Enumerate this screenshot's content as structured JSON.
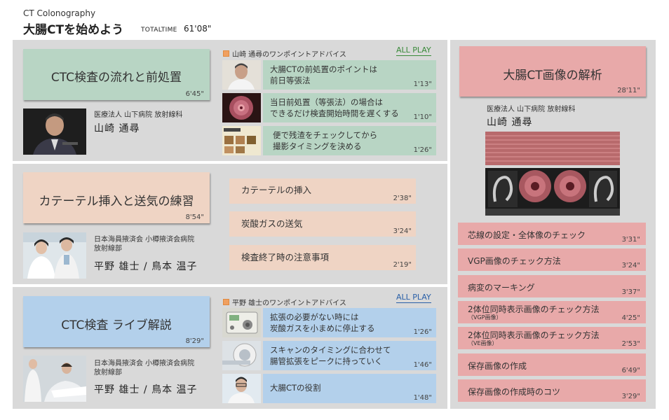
{
  "header": {
    "series": "CT Colonography",
    "title": "大腸CTを始めよう",
    "total_time_label": "TOTALTIME",
    "total_time_value": "61'08\""
  },
  "section1": {
    "main_label": "CTC検査の流れと前処置",
    "main_duration": "6'45\"",
    "doctor_affiliation": "医療法人 山下病院 放射線科",
    "doctor_name": "山崎 通尋",
    "advice_title": "山崎 通尋のワンポイントアドバイス",
    "all_play": "ALL PLAY",
    "items": [
      {
        "line1": "大腸CTの前処置のポイントは",
        "line2": "前日等張法",
        "duration": "1'13\""
      },
      {
        "line1": "当日前処置（等張法）の場合は",
        "line2": "できるだけ検査開始時間を遅くする",
        "duration": "1'10\""
      },
      {
        "line1": "便で残渣をチェックしてから",
        "line2": "撮影タイミングを決める",
        "duration": "1'26\""
      }
    ]
  },
  "section2": {
    "main_label": "カテーテル挿入と送気の練習",
    "main_duration": "8'54\"",
    "doctor_affiliation_1": "日本海員掖済会 小樽掖済会病院",
    "doctor_affiliation_2": "放射線部",
    "doctor_name": "平野 雄士 / 鳥本 温子",
    "items": [
      {
        "label": "カテーテルの挿入",
        "duration": "2'38\""
      },
      {
        "label": "炭酸ガスの送気",
        "duration": "3'24\""
      },
      {
        "label": "検査終了時の注意事項",
        "duration": "2'19\""
      }
    ]
  },
  "section3": {
    "main_label": "CTC検査 ライブ解説",
    "main_duration": "8'29\"",
    "doctor_affiliation_1": "日本海員掖済会 小樽掖済会病院",
    "doctor_affiliation_2": "放射線部",
    "doctor_name": "平野 雄士 / 鳥本 温子",
    "advice_title": "平野 雄士のワンポイントアドバイス",
    "all_play": "ALL PLAY",
    "items": [
      {
        "line1": "拡張の必要がない時には",
        "line2": "炭酸ガスを小まめに停止する",
        "duration": "1'26\""
      },
      {
        "line1": "スキャンのタイミングに合わせて",
        "line2": "腸管拡張をピークに持っていく",
        "duration": "1'46\""
      },
      {
        "line1": "大腸CTの役割",
        "line2": "",
        "duration": "1'48\""
      }
    ]
  },
  "section4": {
    "main_label": "大腸CT画像の解析",
    "main_duration": "28'11\"",
    "doctor_affiliation": "医療法人 山下病院 放射線科",
    "doctor_name": "山崎 通尋",
    "items": [
      {
        "label": "芯線の設定・全体像のチェック",
        "sub": "",
        "duration": "3'31\""
      },
      {
        "label": "VGP画像のチェック方法",
        "sub": "",
        "duration": "3'24\""
      },
      {
        "label": "病変のマーキング",
        "sub": "",
        "duration": "3'37\""
      },
      {
        "label": "2体位同時表示画像のチェック方法",
        "sub": "（VGP画像）",
        "duration": "4'25\""
      },
      {
        "label": "2体位同時表示画像のチェック方法",
        "sub": "（VE画像）",
        "duration": "2'53\""
      },
      {
        "label": "保存画像の作成",
        "sub": "",
        "duration": "6'49\""
      },
      {
        "label": "保存画像の作成時のコツ",
        "sub": "",
        "duration": "3'29\""
      }
    ]
  }
}
